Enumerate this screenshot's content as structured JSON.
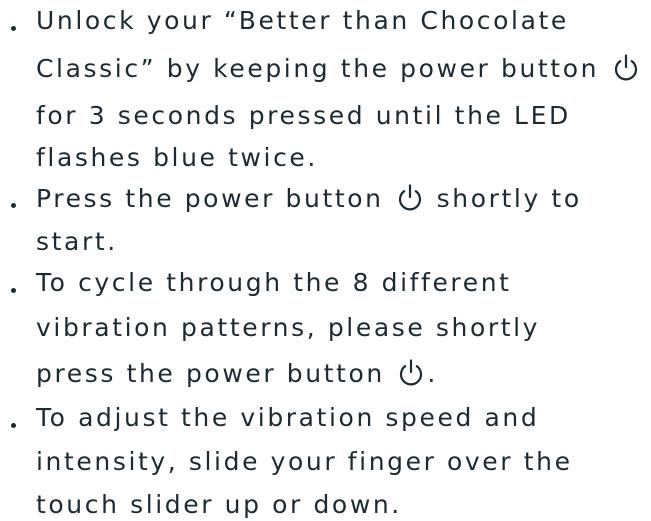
{
  "instructions": [
    {
      "lines": [
        [
          "Unlock your “Better than Chocolate"
        ],
        [
          "Classic” by keeping the power button ",
          {
            "icon": "power-icon"
          }
        ],
        [
          "for 3 seconds pressed until the LED"
        ],
        [
          "flashes blue twice."
        ]
      ]
    },
    {
      "lines": [
        [
          "Press the power button ",
          {
            "icon": "power-icon"
          },
          " shortly to"
        ],
        [
          "start."
        ]
      ]
    },
    {
      "lines": [
        [
          "To cycle through the 8 different"
        ],
        [
          "vibration patterns, please shortly"
        ],
        [
          "press the power button ",
          {
            "icon": "power-icon"
          },
          "."
        ]
      ]
    },
    {
      "lines": [
        [
          "To adjust the vibration speed and"
        ],
        [
          "intensity, slide your finger over the"
        ],
        [
          "touch slider up or down."
        ]
      ]
    }
  ]
}
